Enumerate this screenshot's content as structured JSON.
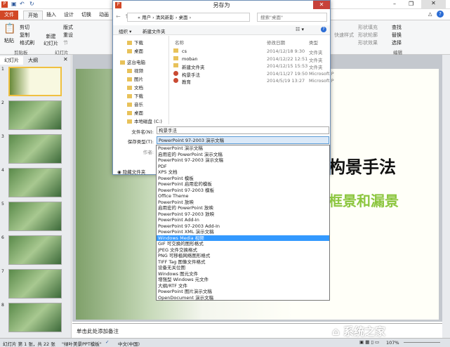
{
  "app": {
    "quick_access": [
      "save",
      "undo",
      "redo"
    ]
  },
  "ribbon": {
    "tabs": [
      "文件",
      "开始",
      "插入",
      "设计",
      "切换",
      "动画"
    ],
    "clipboard": {
      "paste": "粘贴",
      "cut": "剪切",
      "copy": "复制",
      "format_painter": "格式刷",
      "label": "剪贴板"
    },
    "slides": {
      "new_slide": "新建\n幻灯片",
      "layout": "版式",
      "reset": "重设",
      "section": "节",
      "label": "幻灯片"
    },
    "drawing": {
      "quick_styles": "快速样式",
      "shape_fill": "形状填充",
      "shape_outline": "形状轮廓",
      "shape_effects": "形状效果"
    },
    "editing": {
      "find": "查找",
      "replace": "替换",
      "select": "选择",
      "label": "编辑"
    }
  },
  "left_pane": {
    "tabs": [
      "幻灯片",
      "大纲"
    ],
    "thumbnail_count": 8
  },
  "slide": {
    "title": "构景手法",
    "subtitle": "框景和漏景",
    "title_partial": "的"
  },
  "notes": {
    "placeholder": "单击此处添加备注"
  },
  "status": {
    "slide_info": "幻灯片 第 1 张，共 22 张",
    "theme": "\"绿叶美景PPT模板\"",
    "language": "中文(中国)",
    "zoom": "107%"
  },
  "watermark": "系统之家",
  "dialog": {
    "title": "另存为",
    "close": "✕",
    "address": [
      "«",
      "用户",
      "清风新影",
      "桌面"
    ],
    "search_placeholder": "搜索\"桌面\"",
    "organize": "组织 ▾",
    "new_folder": "新建文件夹",
    "nav": [
      "下载",
      "桌面",
      "这台电脑",
      "视频",
      "图片",
      "文档",
      "下载",
      "音乐",
      "桌面",
      "本地磁盘 (C:)"
    ],
    "columns": [
      "名称",
      "修改日期",
      "类型"
    ],
    "files": [
      {
        "name": "cs",
        "date": "2014/12/18 9:30",
        "type": "文件夹",
        "kind": "folder"
      },
      {
        "name": "moban",
        "date": "2014/12/22 12:51",
        "type": "文件夹",
        "kind": "folder"
      },
      {
        "name": "新建文件夹",
        "date": "2014/12/15 15:53",
        "type": "文件夹",
        "kind": "folder"
      },
      {
        "name": "构景手法",
        "date": "2014/11/27 19:50",
        "type": "Microsoft P",
        "kind": "ppt"
      },
      {
        "name": "教育",
        "date": "2014/5/19 13:27",
        "type": "Microsoft P",
        "kind": "ppt"
      }
    ],
    "filename_label": "文件名(N):",
    "filename_value": "构景手法",
    "type_label": "保存类型(T):",
    "type_value": "PowerPoint 97-2003 演示文稿",
    "author_label": "作者:",
    "hide_folders": "隐藏文件夹",
    "type_options": [
      "PowerPoint 演示文稿",
      "启用宏的 PowerPoint 演示文稿",
      "PowerPoint 97-2003 演示文稿",
      "PDF",
      "XPS 文档",
      "PowerPoint 模板",
      "PowerPoint 启用宏的模板",
      "PowerPoint 97-2003 模板",
      "Office Theme",
      "PowerPoint 放映",
      "启用宏的 PowerPoint 放映",
      "PowerPoint 97-2003 放映",
      "PowerPoint Add-In",
      "PowerPoint 97-2003 Add-In",
      "PowerPoint XML 演示文稿",
      "Windows Media 视频",
      "GIF 可交换的图形格式",
      "JPEG 文件交换格式",
      "PNG 可移植网络图形格式",
      "TIFF Tag 图像文件格式",
      "设备无关位图",
      "Windows 图元文件",
      "增强型 Windows 元文件",
      "大纲/RTF 文件",
      "PowerPoint 图片演示文稿",
      "OpenDocument 演示文稿"
    ],
    "highlighted_option": "Windows Media 视频"
  },
  "colors": {
    "file_tab": "#d24726",
    "highlight": "#3399ff",
    "subtitle_green": "#8cc63f"
  }
}
